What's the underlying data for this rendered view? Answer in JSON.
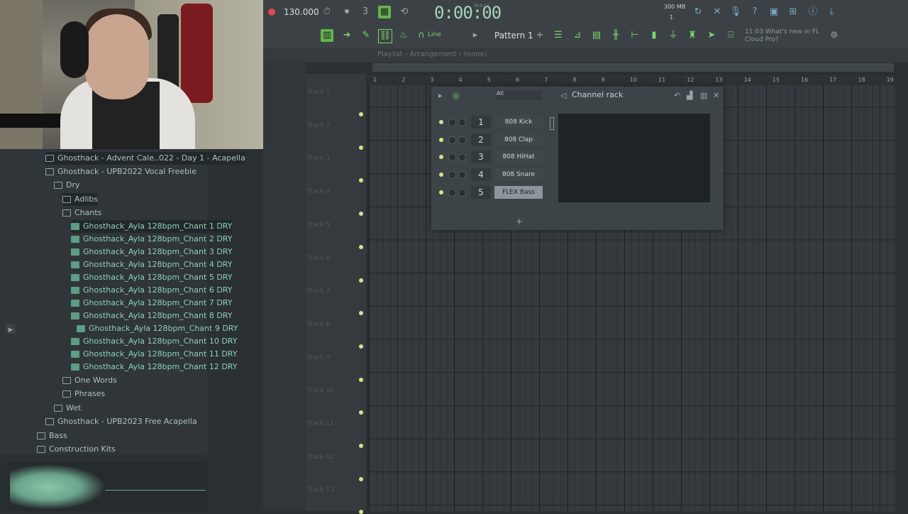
{
  "toolbar": {
    "tempo": "130.000",
    "time": "0:00:00",
    "time_label": "M:S:CS",
    "memory": "300 MB",
    "memory_sub": "1",
    "pattern": "Pattern 1",
    "snap": "Line",
    "news": [
      "11:03 What's new in FL",
      "Cloud Pro?"
    ]
  },
  "playlist": {
    "title": "Playlist - Arrangement › (none)",
    "ruler": [
      "1",
      "2",
      "3",
      "4",
      "5",
      "6",
      "7",
      "8",
      "9",
      "10",
      "11",
      "12",
      "13",
      "14",
      "15",
      "16",
      "17",
      "18",
      "19"
    ],
    "tracks": [
      "Track 1",
      "Track 2",
      "Track 3",
      "Track 4",
      "Track 5",
      "Track 6",
      "Track 7",
      "Track 8",
      "Track 9",
      "Track 10",
      "Track 11",
      "Track 12",
      "Track 13"
    ]
  },
  "channel_rack": {
    "title": "Channel rack",
    "filter": "All",
    "channels": [
      {
        "num": "1",
        "name": "808 Kick"
      },
      {
        "num": "2",
        "name": "808 Clap"
      },
      {
        "num": "3",
        "name": "808 HiHat"
      },
      {
        "num": "4",
        "name": "808 Snare"
      },
      {
        "num": "5",
        "name": "FLEX Bass"
      }
    ],
    "add": "+"
  },
  "browser": {
    "items": [
      {
        "label": "Ghosthack - Advent Cale..022 - Day 1 - Acapella",
        "type": "folder"
      },
      {
        "label": "Ghosthack - UPB2022 Vocal Freebie",
        "type": "folder"
      },
      {
        "label": "Dry",
        "type": "folder"
      },
      {
        "label": "Adlibs",
        "type": "folder"
      },
      {
        "label": "Chants",
        "type": "folder"
      },
      {
        "label": "Ghosthack_Ayla 128bpm_Chant 1 DRY",
        "type": "file"
      },
      {
        "label": "Ghosthack_Ayla 128bpm_Chant 2 DRY",
        "type": "file"
      },
      {
        "label": "Ghosthack_Ayla 128bpm_Chant 3 DRY",
        "type": "file"
      },
      {
        "label": "Ghosthack_Ayla 128bpm_Chant 4 DRY",
        "type": "file"
      },
      {
        "label": "Ghosthack_Ayla 128bpm_Chant 5 DRY",
        "type": "file"
      },
      {
        "label": "Ghosthack_Ayla 128bpm_Chant 6 DRY",
        "type": "file"
      },
      {
        "label": "Ghosthack_Ayla 128bpm_Chant 7 DRY",
        "type": "file"
      },
      {
        "label": "Ghosthack_Ayla 128bpm_Chant 8 DRY",
        "type": "file"
      },
      {
        "label": "Ghosthack_Ayla 128bpm_Chant 9 DRY",
        "type": "file"
      },
      {
        "label": "Ghosthack_Ayla 128bpm_Chant 10 DRY",
        "type": "file"
      },
      {
        "label": "Ghosthack_Ayla 128bpm_Chant 11 DRY",
        "type": "file"
      },
      {
        "label": "Ghosthack_Ayla 128bpm_Chant 12 DRY",
        "type": "file"
      },
      {
        "label": "One Words",
        "type": "folder"
      },
      {
        "label": "Phrases",
        "type": "folder"
      },
      {
        "label": "Wet",
        "type": "folder"
      },
      {
        "label": "Ghosthack - UPB2023 Free Acapella",
        "type": "folder"
      },
      {
        "label": "Bass",
        "type": "folder"
      },
      {
        "label": "Construction Kits",
        "type": "folder"
      }
    ]
  }
}
